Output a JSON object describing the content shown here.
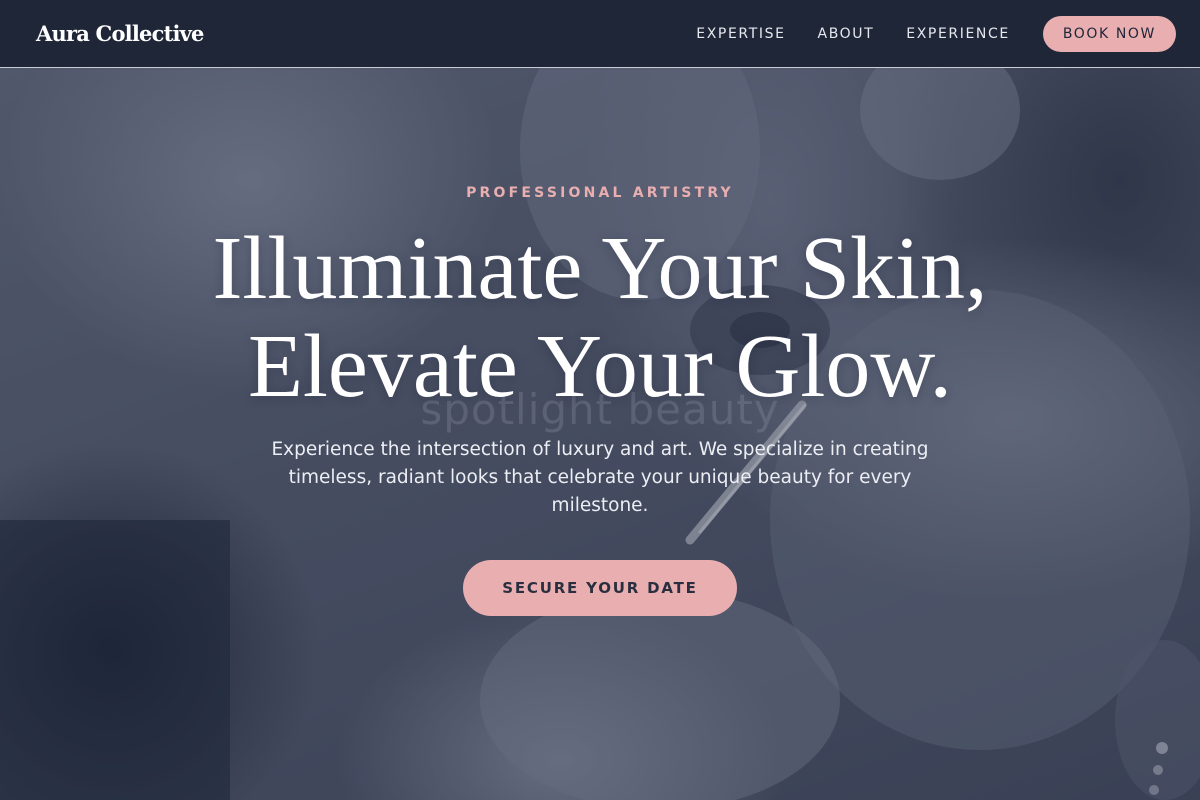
{
  "header": {
    "logo": "Aura Collective",
    "nav": [
      {
        "label": "EXPERTISE"
      },
      {
        "label": "ABOUT"
      },
      {
        "label": "EXPERIENCE"
      }
    ],
    "book_label": "BOOK NOW"
  },
  "hero": {
    "eyebrow": "PROFESSIONAL ARTISTRY",
    "headline_line1": "Illuminate Your Skin,",
    "headline_line2": "Elevate Your Glow.",
    "watermark": "spotlight beauty",
    "subtext": "Experience the intersection of luxury and art. We specialize in creating timeless, radiant looks that celebrate your unique beauty for every milestone.",
    "cta_label": "SECURE YOUR DATE"
  },
  "colors": {
    "navy": "#1e2638",
    "accent_pink": "#e8aeb0",
    "white": "#ffffff"
  },
  "icons": [
    "makeup-brush-graphic"
  ]
}
